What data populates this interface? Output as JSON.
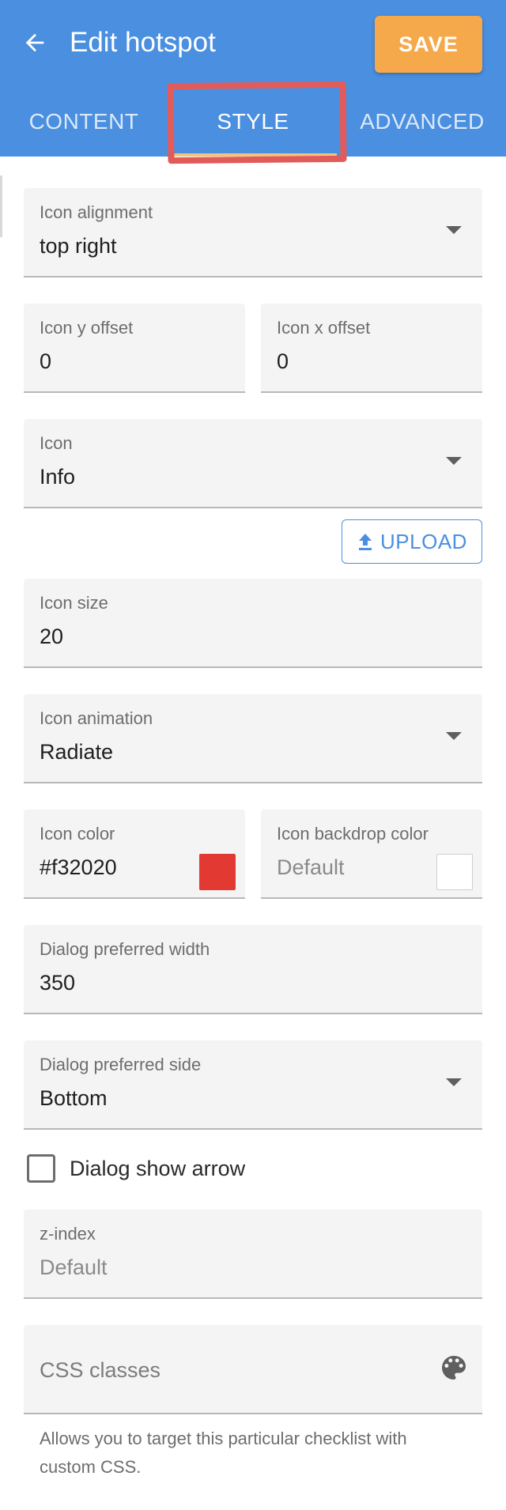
{
  "header": {
    "title": "Edit hotspot",
    "save_label": "SAVE",
    "background": "#4a8fe0",
    "save_color": "#f5a94a"
  },
  "tabs": [
    {
      "label": "CONTENT",
      "active": false
    },
    {
      "label": "STYLE",
      "active": true
    },
    {
      "label": "ADVANCED",
      "active": false
    }
  ],
  "form": {
    "icon_alignment": {
      "label": "Icon alignment",
      "value": "top right"
    },
    "icon_y_offset": {
      "label": "Icon y offset",
      "value": "0"
    },
    "icon_x_offset": {
      "label": "Icon x offset",
      "value": "0"
    },
    "icon": {
      "label": "Icon",
      "value": "Info"
    },
    "upload_label": "UPLOAD",
    "icon_size": {
      "label": "Icon size",
      "value": "20"
    },
    "icon_animation": {
      "label": "Icon animation",
      "value": "Radiate"
    },
    "icon_color": {
      "label": "Icon color",
      "value": "#f32020",
      "swatch": "#e23a33"
    },
    "icon_backdrop_color": {
      "label": "Icon backdrop color",
      "value": "Default",
      "swatch": "#ffffff"
    },
    "dialog_width": {
      "label": "Dialog preferred width",
      "value": "350"
    },
    "dialog_side": {
      "label": "Dialog preferred side",
      "value": "Bottom"
    },
    "dialog_show_arrow": {
      "label": "Dialog show arrow",
      "checked": false
    },
    "z_index": {
      "label": "z-index",
      "value": "Default"
    },
    "css_classes": {
      "placeholder": "CSS classes",
      "helper": "Allows you to target this particular checklist with custom CSS."
    }
  },
  "icons": {
    "back": "arrow-left-icon",
    "dropdown": "chevron-down-icon",
    "upload": "upload-icon",
    "palette": "palette-icon"
  }
}
